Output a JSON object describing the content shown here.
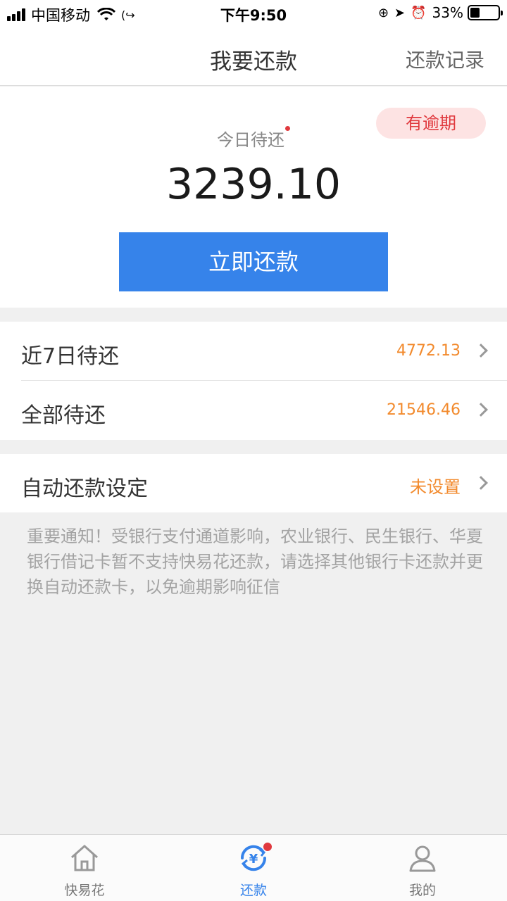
{
  "status_bar": {
    "carrier": "中国移动",
    "time": "下午9:50",
    "battery_percent": "33%",
    "battery_level": 0.33
  },
  "nav": {
    "title": "我要还款",
    "right_link": "还款记录"
  },
  "hero": {
    "overdue_badge": "有逾期",
    "today_label": "今日待还",
    "today_amount": "3239.10",
    "repay_button": "立即还款"
  },
  "list": {
    "rows": [
      {
        "label": "近7日待还",
        "value": "4772.13"
      },
      {
        "label": "全部待还",
        "value": "21546.46"
      }
    ],
    "auto_repay": {
      "label": "自动还款设定",
      "value": "未设置"
    }
  },
  "notice": "重要通知！受银行支付通道影响，农业银行、民生银行、华夏银行借记卡暂不支持快易花还款，请选择其他银行卡还款并更换自动还款卡，以免逾期影响征信",
  "tabs": [
    {
      "label": "快易花",
      "icon": "home-icon"
    },
    {
      "label": "还款",
      "icon": "repay-icon"
    },
    {
      "label": "我的",
      "icon": "user-icon"
    }
  ],
  "colors": {
    "accent": "#3683ea",
    "amount_orange": "#f28a2d",
    "alert_red": "#e0393e"
  }
}
